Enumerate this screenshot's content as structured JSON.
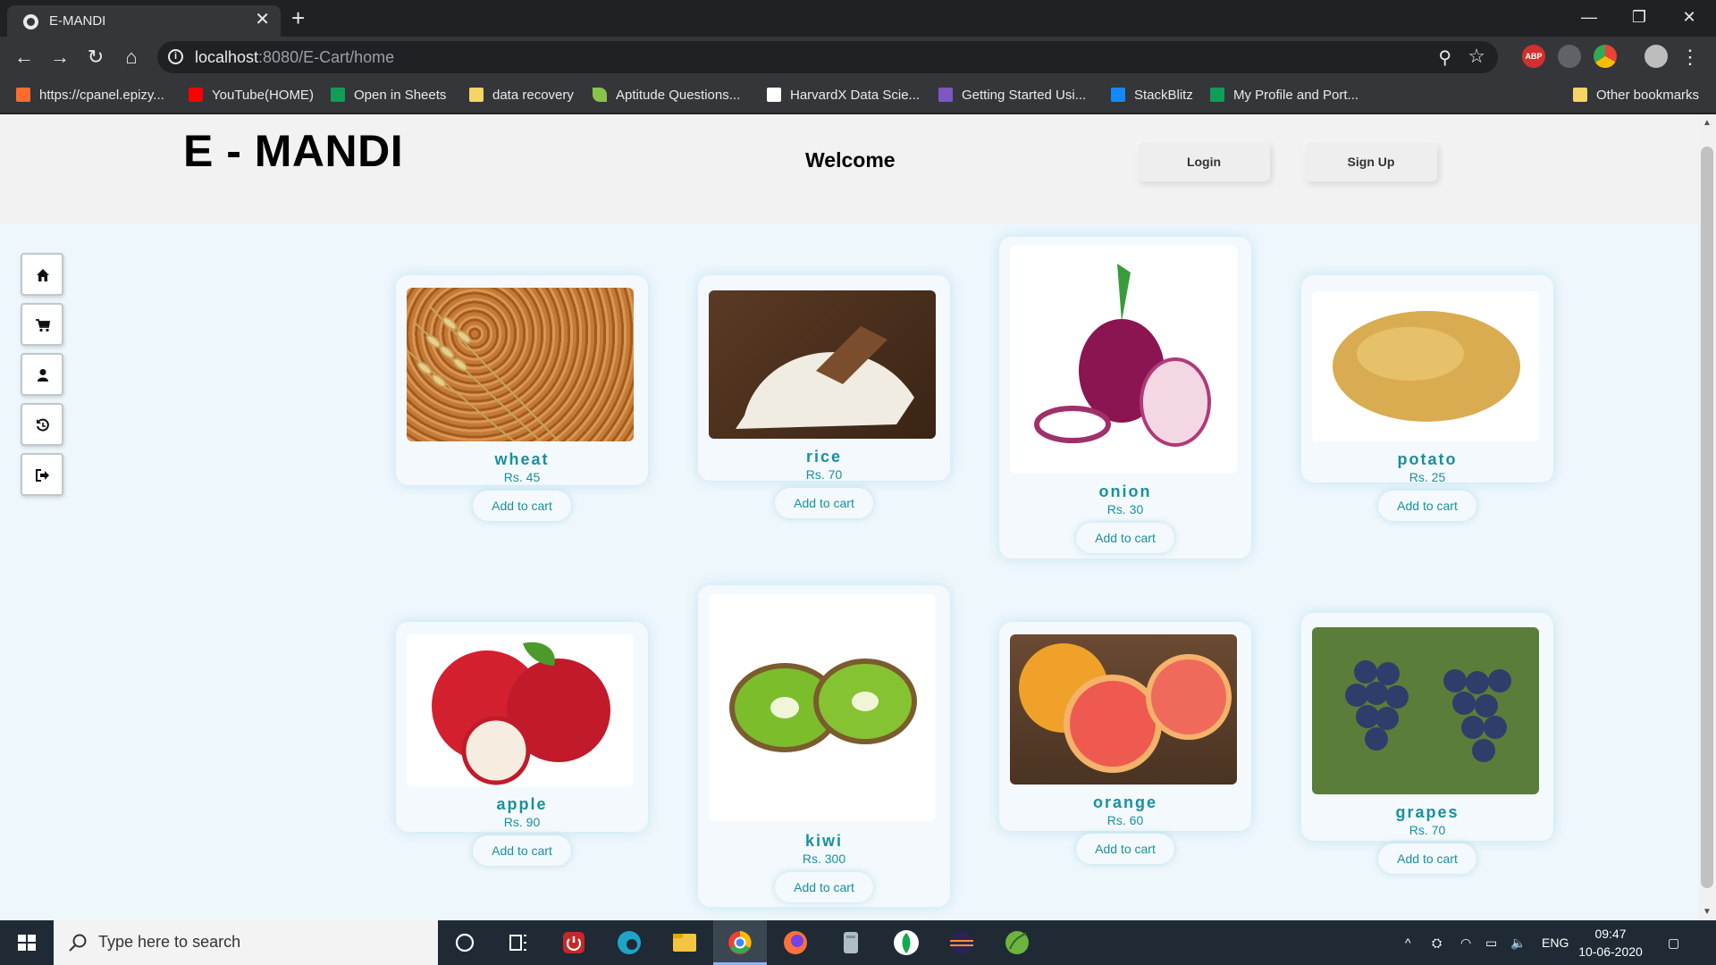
{
  "browser": {
    "tab_title": "E-MANDI",
    "tab_close": "✕",
    "new_tab": "+",
    "url_host": "localhost",
    "url_rest": ":8080/E-Cart/home",
    "window": {
      "minimize": "—",
      "maximize": "❐",
      "close": "✕"
    },
    "extensions": [
      "ABP"
    ],
    "bookmarks": [
      {
        "label": "https://cpanel.epizy...",
        "icon": "cpanel-icon",
        "color": "#ff6c2c"
      },
      {
        "label": "YouTube(HOME)",
        "icon": "youtube-icon",
        "color": "#ff0000"
      },
      {
        "label": "Open in Sheets",
        "icon": "sheets-icon",
        "color": "#0f9d58"
      },
      {
        "label": "data recovery",
        "icon": "folder-icon",
        "color": "#f6d365"
      },
      {
        "label": "Aptitude Questions...",
        "icon": "leaf-icon",
        "color": "#8bc34a"
      },
      {
        "label": "HarvardX Data Scie...",
        "icon": "edx-icon",
        "color": "#ffffff"
      },
      {
        "label": "Getting Started Usi...",
        "icon": "mongo-icon",
        "color": "#7e57c2"
      },
      {
        "label": "StackBlitz",
        "icon": "bolt-icon",
        "color": "#1389fd"
      },
      {
        "label": "My Profile and Port...",
        "icon": "sheets-icon",
        "color": "#0f9d58"
      }
    ],
    "other_bookmarks": "Other bookmarks"
  },
  "page": {
    "brand": "E - MANDI",
    "welcome": "Welcome",
    "login_label": "Login",
    "signup_label": "Sign Up",
    "sidenav": [
      "home-icon",
      "cart-icon",
      "user-icon",
      "history-icon",
      "logout-icon"
    ],
    "products": [
      {
        "name": "wheat",
        "price": "Rs. 45",
        "cta": "Add to cart"
      },
      {
        "name": "rice",
        "price": "Rs. 70",
        "cta": "Add to cart"
      },
      {
        "name": "onion",
        "price": "Rs. 30",
        "cta": "Add to cart"
      },
      {
        "name": "potato",
        "price": "Rs. 25",
        "cta": "Add to cart"
      },
      {
        "name": "apple",
        "price": "Rs. 90",
        "cta": "Add to cart"
      },
      {
        "name": "kiwi",
        "price": "Rs. 300",
        "cta": "Add to cart"
      },
      {
        "name": "orange",
        "price": "Rs. 60",
        "cta": "Add to cart"
      },
      {
        "name": "grapes",
        "price": "Rs. 70",
        "cta": "Add to cart"
      }
    ],
    "accent_color": "#1a8f9e"
  },
  "taskbar": {
    "search_placeholder": "Type here to search",
    "language": "ENG",
    "time": "09:47",
    "date": "10-06-2020"
  }
}
